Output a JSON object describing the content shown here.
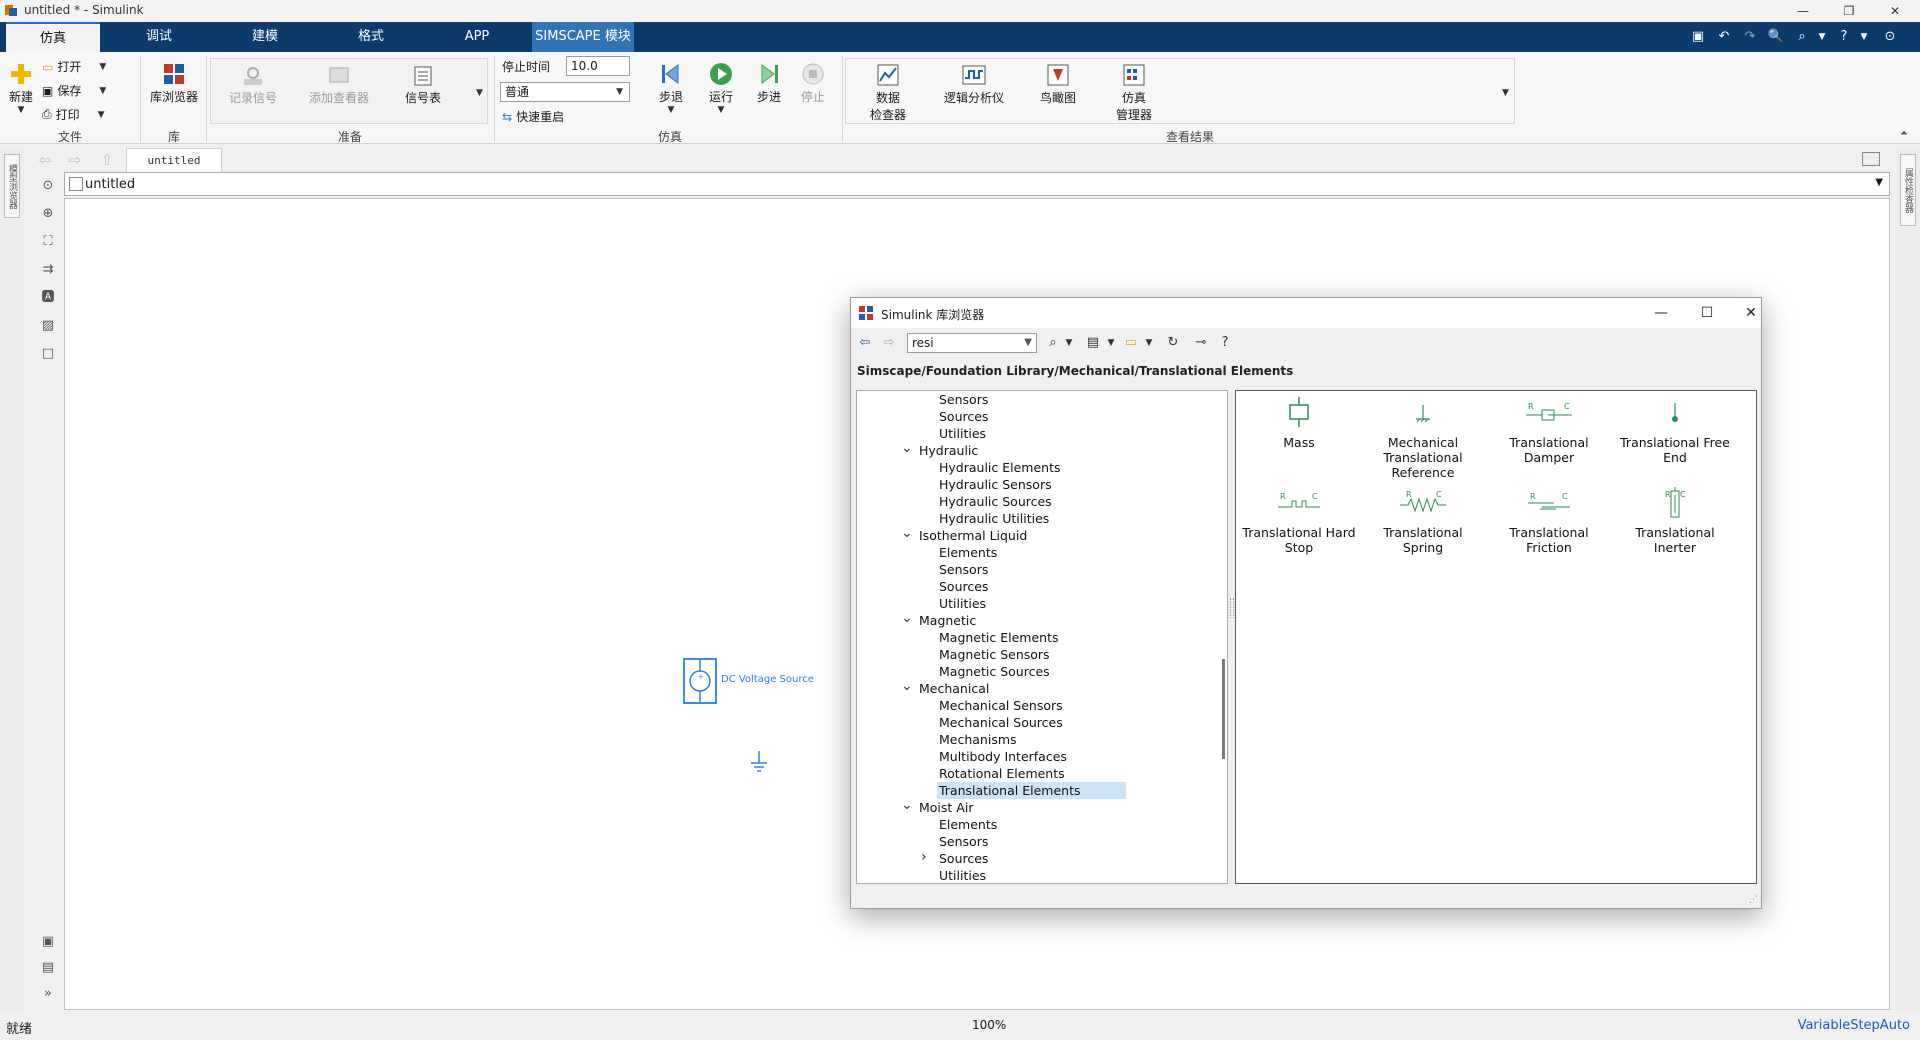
{
  "window": {
    "title": "untitled * - Simulink"
  },
  "ribbon_tabs": [
    "仿真",
    "调试",
    "建模",
    "格式",
    "APP",
    "SIMSCAPE 模块"
  ],
  "ribbon": {
    "file": {
      "new_label": "新建",
      "open_label": "打开",
      "save_label": "保存",
      "print_label": "打印",
      "section_label": "文件"
    },
    "library": {
      "browser_label": "库浏览器",
      "section_label": "库"
    },
    "prepare": {
      "log_signals_label": "记录信号",
      "add_viewer_label": "添加查看器",
      "signal_table_label": "信号表",
      "section_label": "准备"
    },
    "simulate": {
      "stop_time_label": "停止时间",
      "stop_time_value": "10.0",
      "mode_value": "普通",
      "fast_restart_label": "快速重启",
      "step_back_label": "步退",
      "run_label": "运行",
      "step_forward_label": "步进",
      "stop_label": "停止",
      "section_label": "仿真"
    },
    "review": {
      "data_inspector_label": "数据\n检查器",
      "logic_analyzer_label": "逻辑分析仪",
      "birdseye_label": "鸟瞰图",
      "sim_manager_label": "仿真\n管理器",
      "section_label": "查看结果"
    }
  },
  "model": {
    "tab_label": "untitled",
    "address": "untitled"
  },
  "side_panels": {
    "left": "模型浏览器",
    "right": "属性检查器"
  },
  "canvas": {
    "block_label": "DC Voltage Source"
  },
  "status": {
    "ready": "就绪",
    "zoom": "100%",
    "solver": "VariableStepAuto"
  },
  "library_browser": {
    "title": "Simulink 库浏览器",
    "search_value": "resi",
    "path": "Simscape/Foundation Library/Mechanical/Translational Elements",
    "tree": [
      {
        "label": "Sensors",
        "level": 2
      },
      {
        "label": "Sources",
        "level": 2
      },
      {
        "label": "Utilities",
        "level": 2
      },
      {
        "label": "Hydraulic",
        "level": 1,
        "expanded": true
      },
      {
        "label": "Hydraulic Elements",
        "level": 2
      },
      {
        "label": "Hydraulic Sensors",
        "level": 2
      },
      {
        "label": "Hydraulic Sources",
        "level": 2
      },
      {
        "label": "Hydraulic Utilities",
        "level": 2
      },
      {
        "label": "Isothermal Liquid",
        "level": 1,
        "expanded": true
      },
      {
        "label": "Elements",
        "level": 2
      },
      {
        "label": "Sensors",
        "level": 2
      },
      {
        "label": "Sources",
        "level": 2
      },
      {
        "label": "Utilities",
        "level": 2
      },
      {
        "label": "Magnetic",
        "level": 1,
        "expanded": true
      },
      {
        "label": "Magnetic Elements",
        "level": 2
      },
      {
        "label": "Magnetic Sensors",
        "level": 2
      },
      {
        "label": "Magnetic Sources",
        "level": 2
      },
      {
        "label": "Mechanical",
        "level": 1,
        "expanded": true
      },
      {
        "label": "Mechanical Sensors",
        "level": 2
      },
      {
        "label": "Mechanical Sources",
        "level": 2
      },
      {
        "label": "Mechanisms",
        "level": 2
      },
      {
        "label": "Multibody Interfaces",
        "level": 2
      },
      {
        "label": "Rotational Elements",
        "level": 2
      },
      {
        "label": "Translational Elements",
        "level": 2,
        "selected": true
      },
      {
        "label": "Moist Air",
        "level": 1,
        "expanded": true
      },
      {
        "label": "Elements",
        "level": 2
      },
      {
        "label": "Sensors",
        "level": 2
      },
      {
        "label": "Sources",
        "level": 2,
        "collapsed": true
      },
      {
        "label": "Utilities",
        "level": 2
      }
    ],
    "blocks": [
      {
        "label": "Mass",
        "icon": "mass-icon"
      },
      {
        "label": "Mechanical Translational Reference",
        "icon": "reference-icon"
      },
      {
        "label": "Translational Damper",
        "icon": "damper-icon"
      },
      {
        "label": "Translational Free End",
        "icon": "free-end-icon"
      },
      {
        "label": "Translational Hard Stop",
        "icon": "hard-stop-icon"
      },
      {
        "label": "Translational Spring",
        "icon": "spring-icon"
      },
      {
        "label": "Translational Friction",
        "icon": "friction-icon"
      },
      {
        "label": "Translational Inerter",
        "icon": "inerter-icon"
      }
    ],
    "port_labels": {
      "r": "R",
      "c": "C"
    }
  },
  "colors": {
    "ribbon_tab_bg": "#0c3a6b",
    "simscape_tab": "#3373b8",
    "accent": "#2f7de0",
    "block_green": "#2e8b57",
    "selection": "#cce4f7"
  }
}
